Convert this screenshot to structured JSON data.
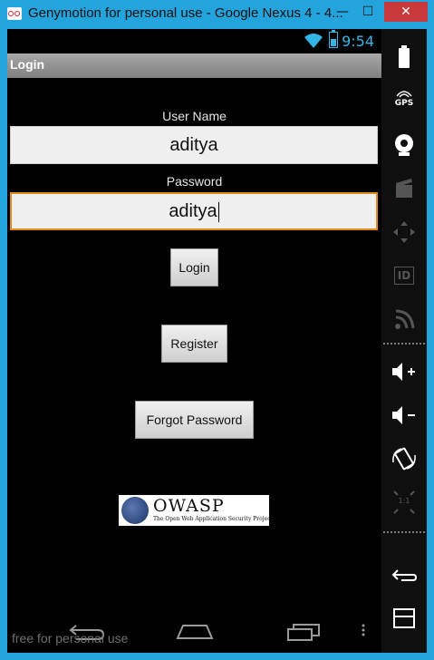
{
  "window": {
    "title": "Genymotion for personal use - Google Nexus 4 - 4...",
    "minimize_glyph": "—",
    "maximize_glyph": "☐",
    "close_glyph": "✕"
  },
  "statusbar": {
    "time": "9:54"
  },
  "actionbar": {
    "title": "Login"
  },
  "form": {
    "username_label": "User Name",
    "username_value": "aditya",
    "password_label": "Password",
    "password_value": "aditya"
  },
  "buttons": {
    "login": "Login",
    "register": "Register",
    "forgot": "Forgot Password"
  },
  "logo": {
    "name": "OWASP",
    "tagline": "The Open Web Application Security Project"
  },
  "watermark": "free for personal use",
  "sidebar": {
    "gps_label": "GPS",
    "id_label": "ID",
    "ratio_label": "1:1"
  },
  "colors": {
    "title_bar": "#24a4dc",
    "status_accent": "#33b5e5",
    "focus_border": "#e88a1a",
    "close_button": "#c7393a"
  }
}
